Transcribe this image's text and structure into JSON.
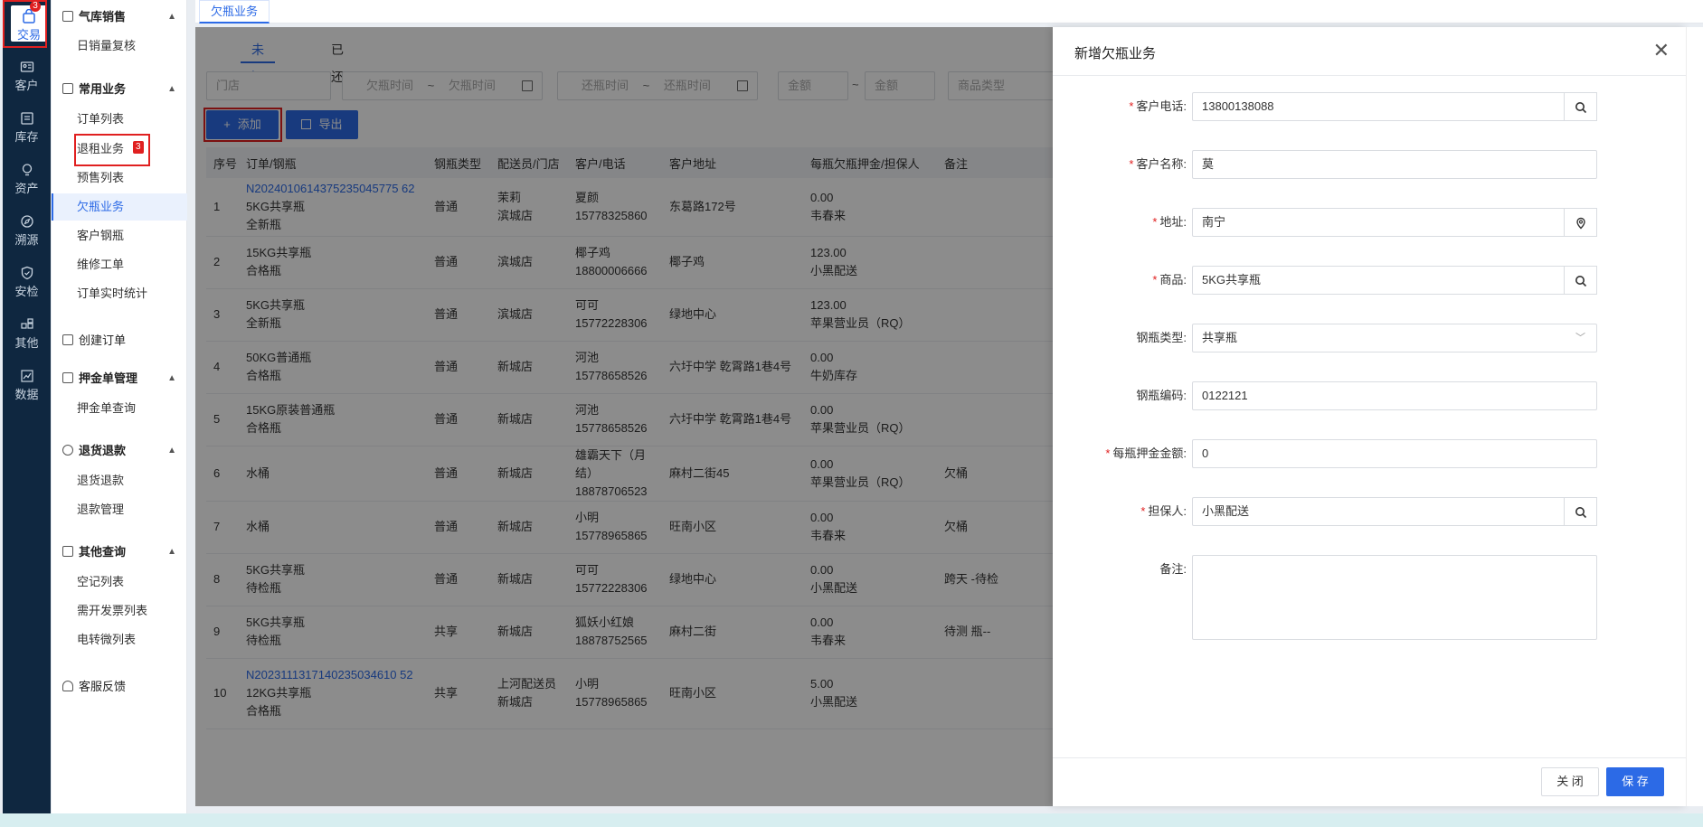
{
  "rail": {
    "items": [
      {
        "label": "交易",
        "icon": "bag-icon",
        "badge": "3"
      },
      {
        "label": "客户",
        "icon": "id-card-icon"
      },
      {
        "label": "库存",
        "icon": "inventory-icon"
      },
      {
        "label": "资产",
        "icon": "bulb-icon"
      },
      {
        "label": "溯源",
        "icon": "compass-icon"
      },
      {
        "label": "安检",
        "icon": "shield-icon"
      },
      {
        "label": "其他",
        "icon": "apps-icon"
      },
      {
        "label": "数据",
        "icon": "chart-icon"
      }
    ]
  },
  "menu": {
    "g1": "气库销售",
    "g1_i1": "日销量复核",
    "g2": "常用业务",
    "g2_i1": "订单列表",
    "g2_i2": "退租业务",
    "g2_i2_badge": "3",
    "g2_i3": "预售列表",
    "g2_i4": "欠瓶业务",
    "g2_i5": "客户钢瓶",
    "g2_i6": "维修工单",
    "g2_i7": "订单实时统计",
    "g3": "创建订单",
    "g4": "押金单管理",
    "g4_i1": "押金单查询",
    "g5": "退货退款",
    "g5_i1": "退货退款",
    "g5_i2": "退款管理",
    "g6": "其他查询",
    "g6_i1": "空记列表",
    "g6_i2": "需开发票列表",
    "g6_i3": "电转微列表",
    "g7": "客服反馈"
  },
  "tabstrip": {
    "active": "欠瓶业务"
  },
  "subtabs": {
    "t1": "未还",
    "t2": "已还"
  },
  "filters": {
    "store": "门店",
    "owe_start": "欠瓶时间",
    "owe_sep": "~",
    "owe_end": "欠瓶时间",
    "ret_start": "还瓶时间",
    "ret_sep": "~",
    "ret_end": "还瓶时间",
    "amt_min": "金额",
    "amt_sep": "~",
    "amt_max": "金额",
    "goods_type": "商品类型"
  },
  "toolbar": {
    "add": "添加",
    "export": "导出"
  },
  "table": {
    "headers": [
      "序号",
      "订单/钢瓶",
      "钢瓶类型",
      "配送员/门店",
      "客户/电话",
      "客户地址",
      "每瓶欠瓶押金/担保人",
      "备注"
    ],
    "rows": [
      {
        "no": "1",
        "order": "N2024010614375235045775 62",
        "goods": "5KG共享瓶",
        "state": "全新瓶",
        "type": "普通",
        "staff": "茉莉",
        "store": "滨城店",
        "cust": "夏颜",
        "phone": "15778325860",
        "addr": "东葛路172号",
        "dep": "0.00",
        "guar": "韦春来",
        "note": ""
      },
      {
        "no": "2",
        "order": "",
        "goods": "15KG共享瓶",
        "state": "合格瓶",
        "type": "普通",
        "staff": "",
        "store": "滨城店",
        "cust": "椰子鸡",
        "phone": "18800006666",
        "addr": "椰子鸡",
        "dep": "123.00",
        "guar": "小黑配送",
        "note": ""
      },
      {
        "no": "3",
        "order": "",
        "goods": "5KG共享瓶",
        "state": "全新瓶",
        "type": "普通",
        "staff": "",
        "store": "滨城店",
        "cust": "可可",
        "phone": "15772228306",
        "addr": "绿地中心",
        "dep": "123.00",
        "guar": "苹果营业员（RQ）",
        "note": ""
      },
      {
        "no": "4",
        "order": "",
        "goods": "50KG普通瓶",
        "state": "合格瓶",
        "type": "普通",
        "staff": "",
        "store": "新城店",
        "cust": "河池",
        "phone": "15778658526",
        "addr": "六圩中学 乾霄路1巷4号",
        "dep": "0.00",
        "guar": "牛奶库存",
        "note": ""
      },
      {
        "no": "5",
        "order": "",
        "goods": "15KG原装普通瓶",
        "state": "合格瓶",
        "type": "普通",
        "staff": "",
        "store": "新城店",
        "cust": "河池",
        "phone": "15778658526",
        "addr": "六圩中学 乾霄路1巷4号",
        "dep": "0.00",
        "guar": "苹果营业员（RQ）",
        "note": ""
      },
      {
        "no": "6",
        "order": "",
        "goods": "水桶",
        "state": "",
        "type": "普通",
        "staff": "",
        "store": "新城店",
        "cust": "雄霸天下（月结）",
        "phone": "18878706523",
        "addr": "麻村二街45",
        "dep": "0.00",
        "guar": "苹果营业员（RQ）",
        "note": "欠桶"
      },
      {
        "no": "7",
        "order": "",
        "goods": "水桶",
        "state": "",
        "type": "普通",
        "staff": "",
        "store": "新城店",
        "cust": "小明",
        "phone": "15778965865",
        "addr": "旺南小区",
        "dep": "0.00",
        "guar": "韦春来",
        "note": "欠桶"
      },
      {
        "no": "8",
        "order": "",
        "goods": "5KG共享瓶",
        "state": "待检瓶",
        "type": "普通",
        "staff": "",
        "store": "新城店",
        "cust": "可可",
        "phone": "15772228306",
        "addr": "绿地中心",
        "dep": "0.00",
        "guar": "小黑配送",
        "note": "跨天 -待检"
      },
      {
        "no": "9",
        "order": "",
        "goods": "5KG共享瓶",
        "state": "待检瓶",
        "type": "共享",
        "staff": "",
        "store": "新城店",
        "cust": "狐妖小红娘",
        "phone": "18878752565",
        "addr": "麻村二街",
        "dep": "0.00",
        "guar": "韦春来",
        "note": "待测 瓶--"
      },
      {
        "no": "10",
        "order": "N2023111317140235034610 52",
        "goods": "12KG共享瓶",
        "state": "合格瓶",
        "type": "共享",
        "staff": "上河配送员",
        "store": "新城店",
        "cust": "小明",
        "phone": "15778965865",
        "addr": "旺南小区",
        "dep": "5.00",
        "guar": "小黑配送",
        "note": ""
      }
    ]
  },
  "drawer": {
    "title": "新增欠瓶业务",
    "phone_label": "客户电话:",
    "phone": "13800138088",
    "name_label": "客户名称:",
    "name": "莫",
    "addr_label": "地址:",
    "addr": "南宁",
    "goods_label": "商品:",
    "goods": "5KG共享瓶",
    "type_label": "钢瓶类型:",
    "type": "共享瓶",
    "code_label": "钢瓶编码:",
    "code": "0122121",
    "deposit_label": "每瓶押金金额:",
    "deposit": "0",
    "guarantor_label": "担保人:",
    "guarantor": "小黑配送",
    "note_label": "备注:",
    "close": "关 闭",
    "save": "保 存"
  }
}
